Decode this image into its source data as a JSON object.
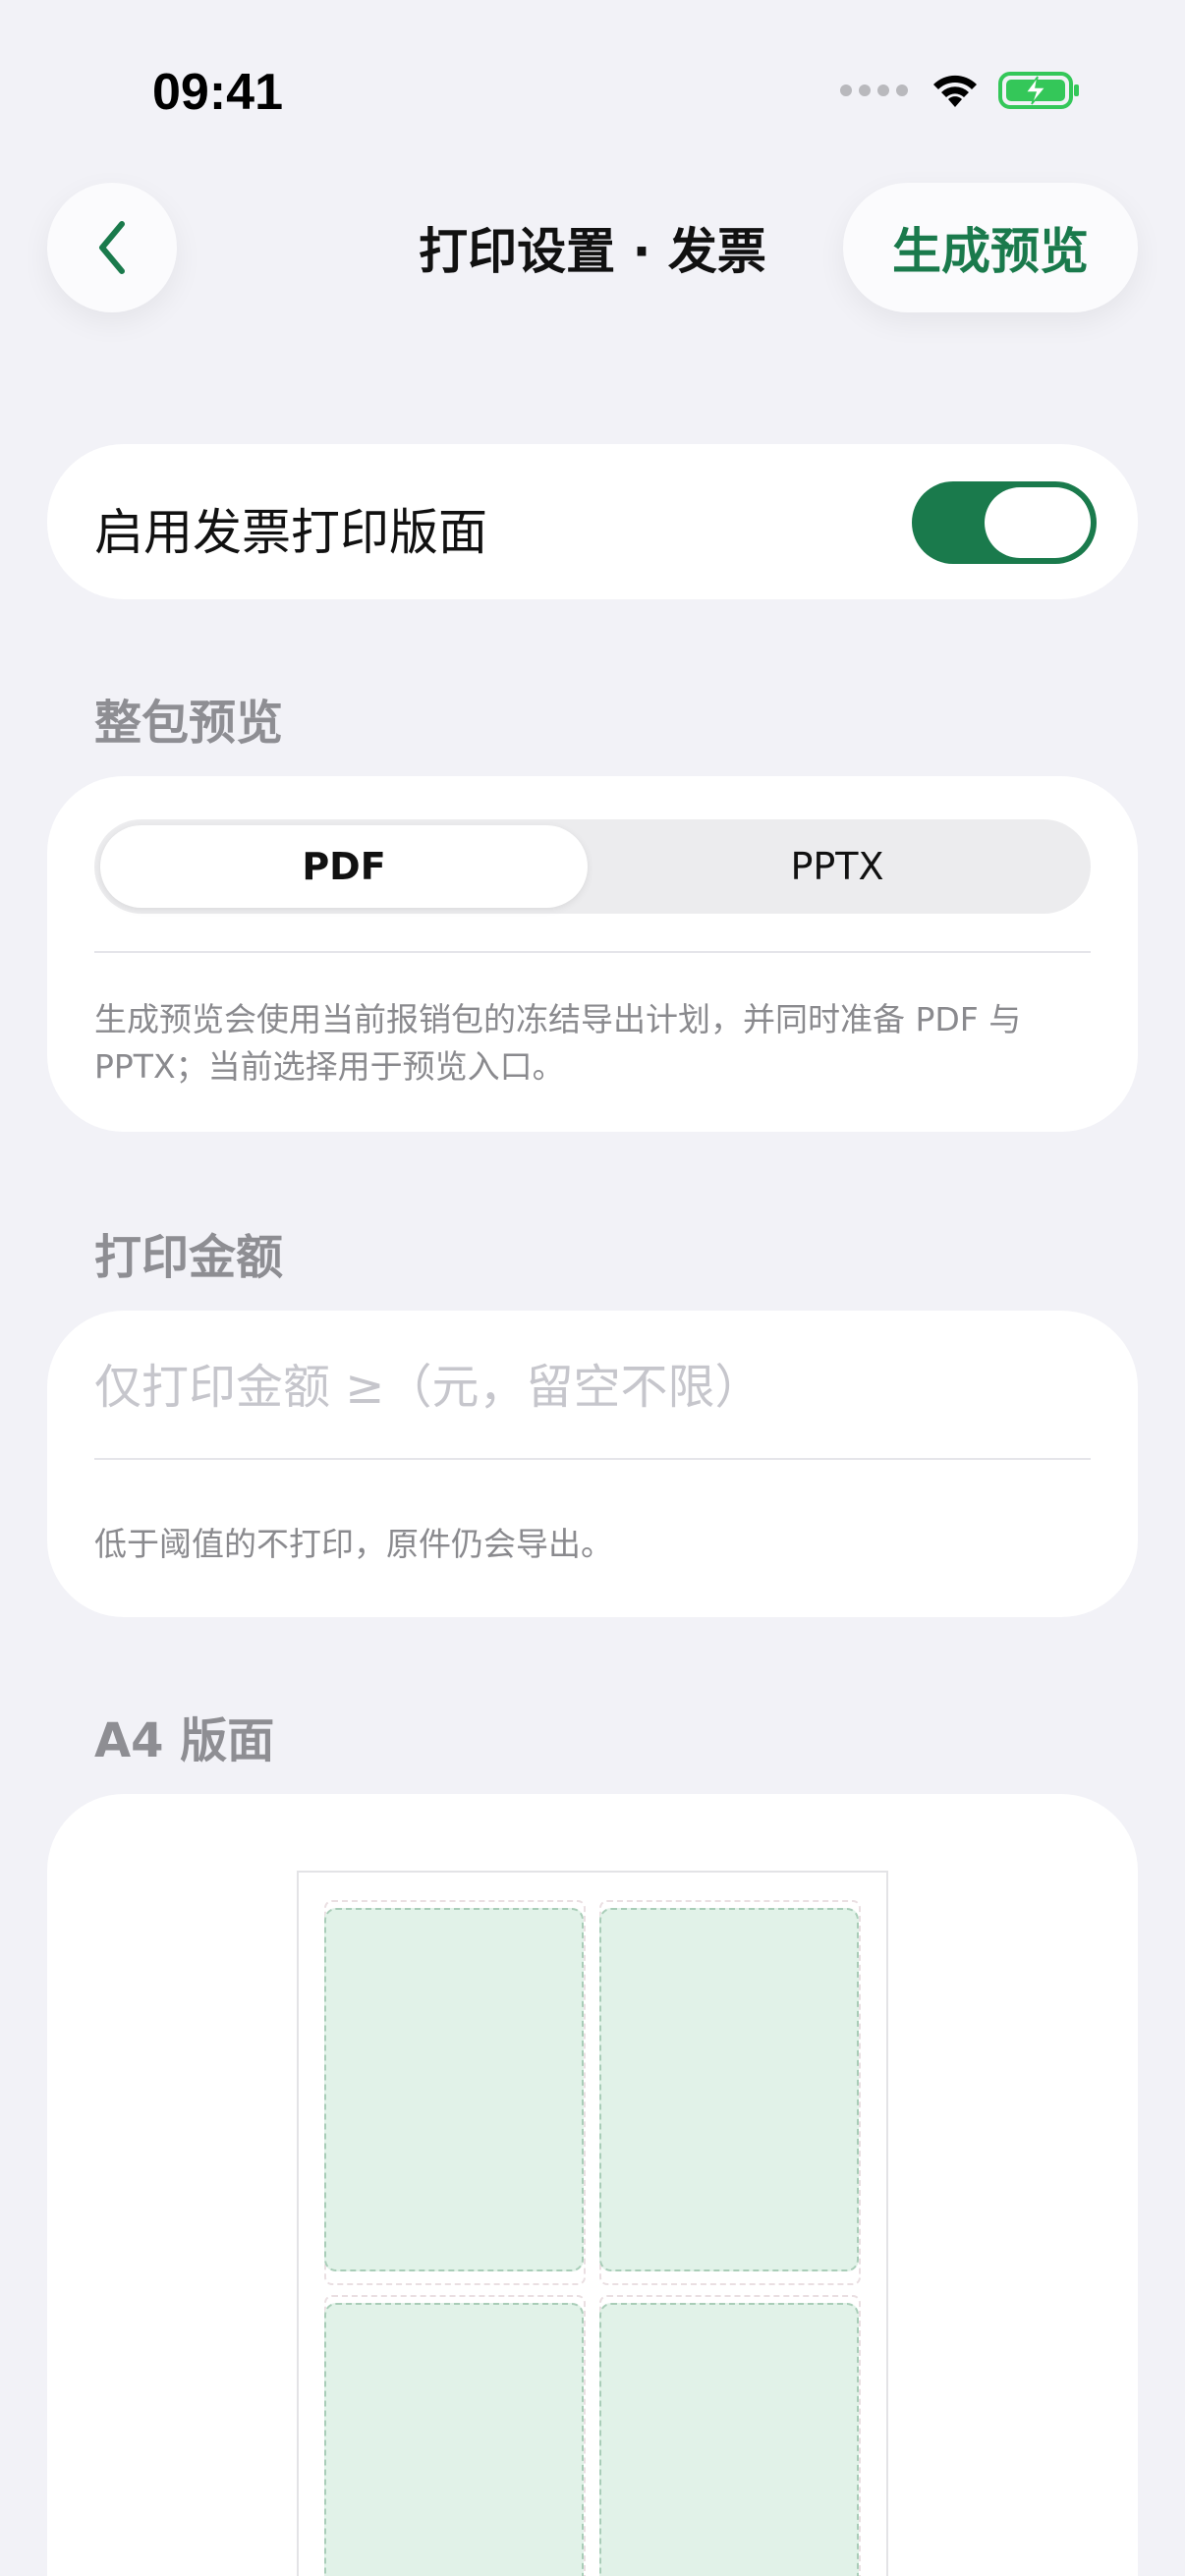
{
  "status_bar": {
    "time": "09:41",
    "icons": [
      "signal-dots-icon",
      "wifi-icon",
      "battery-charging-icon"
    ],
    "battery_color": "#34c759"
  },
  "nav": {
    "back_icon": "chevron-left-icon",
    "title": "打印设置 · 发票",
    "action_label": "生成预览"
  },
  "toggle_row": {
    "label": "启用发票打印版面",
    "enabled": true
  },
  "preview_section": {
    "header": "整包预览",
    "options": [
      "PDF",
      "PPTX"
    ],
    "selected": "PDF",
    "hint": "生成预览会使用当前报销包的冻结导出计划，并同时准备 PDF 与 PPTX；当前选择用于预览入口。"
  },
  "amount_section": {
    "header": "打印金额",
    "placeholder": "仅打印金额 ≥（元，留空不限）",
    "value": "",
    "hint": "低于阈值的不打印，原件仍会导出。"
  },
  "layout_section": {
    "header": "A4 版面",
    "invoices_per_page_visible": 4
  },
  "colors": {
    "accent": "#1a7a4c",
    "background": "#f2f2f7",
    "slot_fill": "#e1f2e8"
  }
}
